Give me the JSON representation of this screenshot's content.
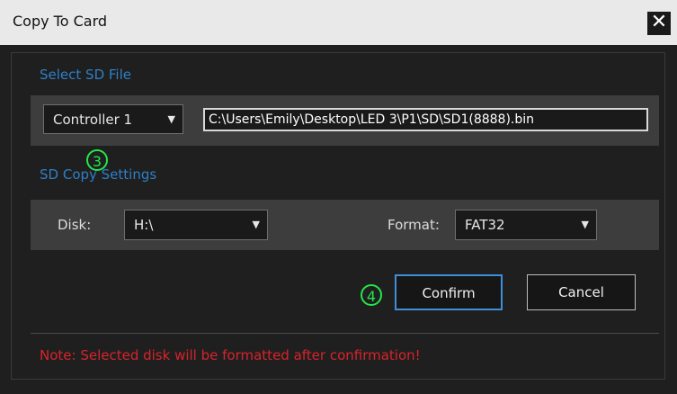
{
  "dialog": {
    "title": "Copy To Card",
    "close_glyph": "✕"
  },
  "sd_file": {
    "section_label": "Select SD File",
    "controller_value": "Controller 1",
    "path_value": "C:\\Users\\Emily\\Desktop\\LED 3\\P1\\SD\\SD1(8888).bin"
  },
  "sd_copy": {
    "section_label": "SD Copy Settings",
    "disk_label": "Disk:",
    "disk_value": "H:\\",
    "format_label": "Format:",
    "format_value": "FAT32"
  },
  "buttons": {
    "confirm_label": "Confirm",
    "cancel_label": "Cancel"
  },
  "markers": {
    "step3": "3",
    "step4": "4"
  },
  "note": "Note: Selected disk will be formatted after confirmation!",
  "colors": {
    "accent_blue": "#2f7fc8",
    "marker_green": "#23e64a",
    "warning_red": "#d9232b"
  },
  "icons": {
    "dropdown": "chevron-down-icon",
    "close": "close-icon"
  }
}
